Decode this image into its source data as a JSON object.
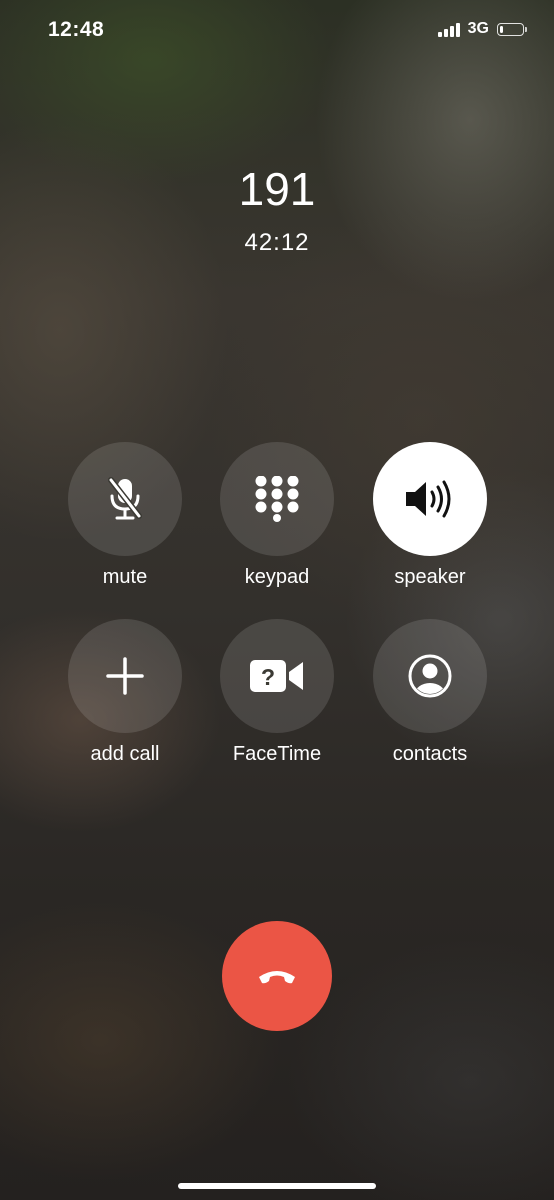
{
  "status_bar": {
    "time": "12:48",
    "network": "3G",
    "signal_bars": 4,
    "battery_level": 0.15
  },
  "call": {
    "number": "191",
    "duration": "42:12"
  },
  "controls": {
    "mute": {
      "label": "mute",
      "icon": "microphone-slash-icon",
      "active": false
    },
    "keypad": {
      "label": "keypad",
      "icon": "keypad-dots-icon",
      "active": false
    },
    "speaker": {
      "label": "speaker",
      "icon": "speaker-wave-icon",
      "active": true
    },
    "add_call": {
      "label": "add call",
      "icon": "plus-icon",
      "active": false
    },
    "facetime": {
      "label": "FaceTime",
      "icon": "facetime-unavailable-icon",
      "active": false
    },
    "contacts": {
      "label": "contacts",
      "icon": "person-circle-icon",
      "active": false
    }
  },
  "end_call": {
    "icon": "phone-hangup-icon",
    "color": "#eb5545"
  }
}
